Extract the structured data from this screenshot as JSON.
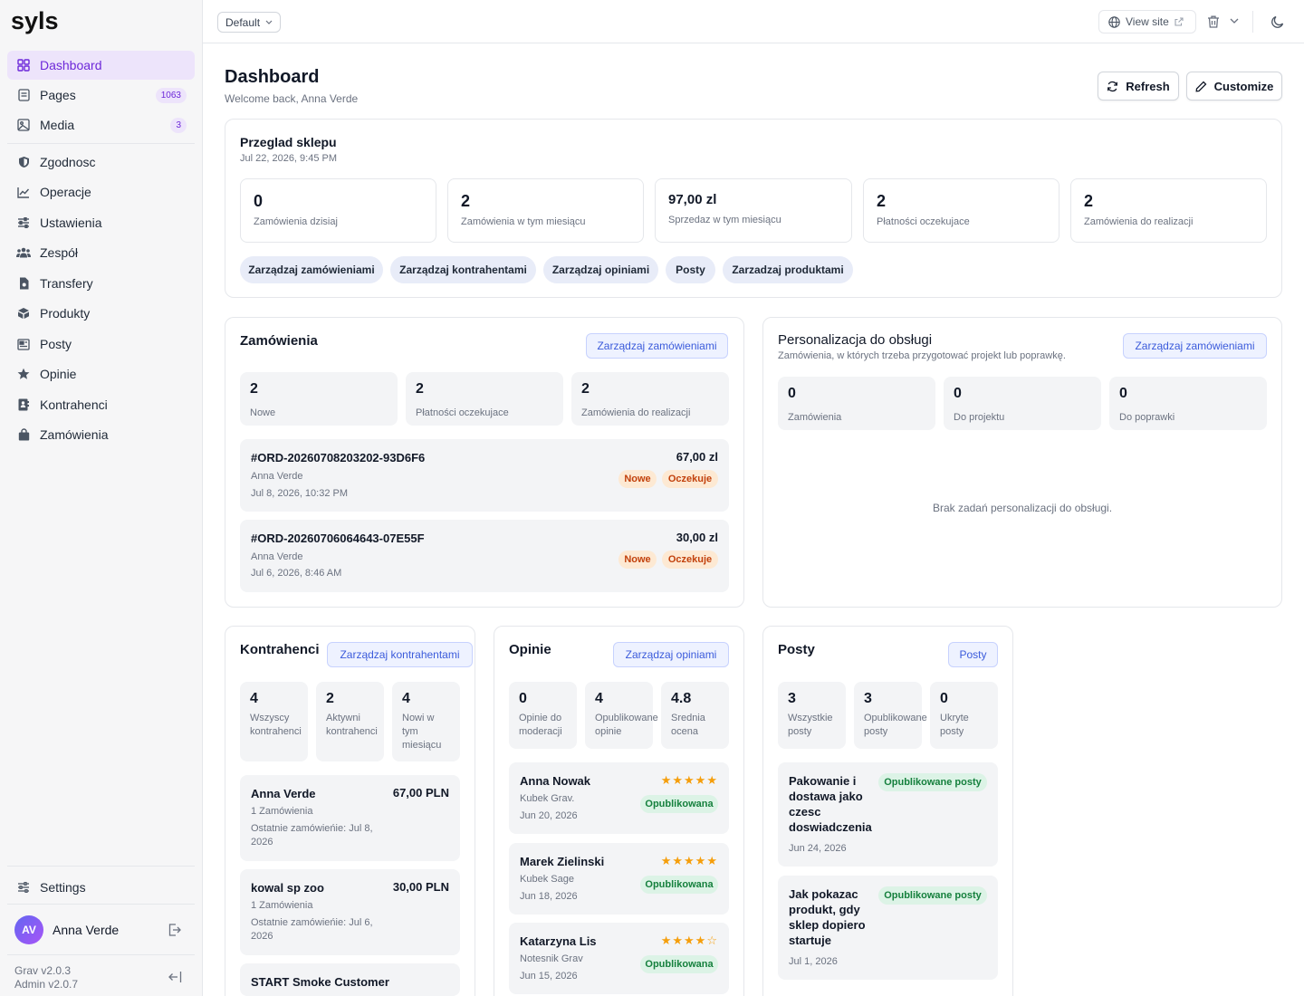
{
  "brand": {
    "logo_text": "syls"
  },
  "sidebar": {
    "items": [
      {
        "label": "Dashboard",
        "icon": "dashboard-icon"
      },
      {
        "label": "Pages",
        "icon": "pages-icon",
        "badge": "1063"
      },
      {
        "label": "Media",
        "icon": "media-icon",
        "badge": "3"
      },
      {
        "label": "Zgodnosc",
        "icon": "shield-icon"
      },
      {
        "label": "Operacje",
        "icon": "chart-line-icon"
      },
      {
        "label": "Ustawienia",
        "icon": "sliders-icon"
      },
      {
        "label": "Zespół",
        "icon": "team-icon"
      },
      {
        "label": "Transfery",
        "icon": "file-transfer-icon"
      },
      {
        "label": "Produkty",
        "icon": "box-icon"
      },
      {
        "label": "Posty",
        "icon": "newspaper-icon"
      },
      {
        "label": "Opinie",
        "icon": "star-icon"
      },
      {
        "label": "Kontrahenci",
        "icon": "contacts-icon"
      },
      {
        "label": "Zamówienia",
        "icon": "bag-icon"
      }
    ],
    "settings_label": "Settings",
    "user": {
      "initials": "AV",
      "name": "Anna Verde"
    },
    "version": {
      "grav": "Grav v2.0.3",
      "admin": "Admin v2.0.7"
    }
  },
  "topbar": {
    "environment": "Default",
    "view_site": "View site"
  },
  "header": {
    "title": "Dashboard",
    "subtitle": "Welcome back, Anna Verde",
    "refresh": "Refresh",
    "customize": "Customize"
  },
  "overview": {
    "title": "Przeglad sklepu",
    "timestamp": "Jul 22, 2026, 9:45 PM",
    "stats": [
      {
        "value": "0",
        "label": "Zamówienia dzisiaj"
      },
      {
        "value": "2",
        "label": "Zamówienia w tym miesiącu"
      },
      {
        "value": "97,00 zl",
        "label": "Sprzedaz w tym miesiącu"
      },
      {
        "value": "2",
        "label": "Płatności oczekujace"
      },
      {
        "value": "2",
        "label": "Zamówienia do realizacji"
      }
    ],
    "quick_links": [
      "Zarządzaj zamówieniami",
      "Zarządzaj kontrahentami",
      "Zarządzaj opiniami",
      "Posty",
      "Zarzadzaj produktami"
    ]
  },
  "orders": {
    "title": "Zamówienia",
    "manage": "Zarządzaj zamówieniami",
    "stats": [
      {
        "value": "2",
        "label": "Nowe"
      },
      {
        "value": "2",
        "label": "Płatności oczekujace"
      },
      {
        "value": "2",
        "label": "Zamówienia do realizacji"
      }
    ],
    "list": [
      {
        "id": "#ORD-20260708203202-93D6F6",
        "customer": "Anna Verde",
        "date": "Jul 8, 2026, 10:32 PM",
        "amount": "67,00 zl",
        "tags": [
          "Nowe",
          "Oczekuje"
        ]
      },
      {
        "id": "#ORD-20260706064643-07E55F",
        "customer": "Anna Verde",
        "date": "Jul 6, 2026, 8:46 AM",
        "amount": "30,00 zl",
        "tags": [
          "Nowe",
          "Oczekuje"
        ]
      }
    ]
  },
  "personalization": {
    "title": "Personalizacja do obsługi",
    "subtitle": "Zamówienia, w których trzeba przygotować projekt lub poprawkę.",
    "manage": "Zarządzaj zamówieniami",
    "stats": [
      {
        "value": "0",
        "label": "Zamówienia"
      },
      {
        "value": "0",
        "label": "Do projektu"
      },
      {
        "value": "0",
        "label": "Do poprawki"
      }
    ],
    "empty": "Brak zadań personalizacji do obsługi."
  },
  "contractors": {
    "title": "Kontrahenci",
    "manage": "Zarządzaj kontrahentami",
    "stats": [
      {
        "value": "4",
        "label_lines": [
          "Wszyscy",
          "kontrahenci"
        ]
      },
      {
        "value": "2",
        "label_lines": [
          "Aktywni",
          "kontrahenci"
        ]
      },
      {
        "value": "4",
        "label_lines": [
          "Nowi w",
          "tym",
          "miesiącu"
        ]
      }
    ],
    "list": [
      {
        "name": "Anna Verde",
        "orders": "1 Zamówienia",
        "last_line1": "Ostatnie zamówieńie: Jul 8,",
        "last_line2": "2026",
        "amount": "67,00 PLN"
      },
      {
        "name": "kowal sp zoo",
        "orders": "1 Zamówienia",
        "last_line1": "Ostatnie zamówieńie: Jul 6,",
        "last_line2": "2026",
        "amount": "30,00 PLN"
      },
      {
        "name": "START Smoke Customer"
      }
    ]
  },
  "reviews": {
    "title": "Opinie",
    "manage": "Zarządzaj opiniami",
    "stats": [
      {
        "value": "0",
        "label_lines": [
          "Opinie do",
          "moderacji"
        ]
      },
      {
        "value": "4",
        "label_lines": [
          "Opublikowane",
          "opinie"
        ]
      },
      {
        "value": "4.8",
        "label_lines": [
          "Srednia",
          "ocena"
        ]
      }
    ],
    "list": [
      {
        "author": "Anna Nowak",
        "product": "Kubek Grav.",
        "date": "Jun 20, 2026",
        "rating": 5,
        "status": "Opublikowana"
      },
      {
        "author": "Marek Zielinski",
        "product": "Kubek Sage",
        "date": "Jun 18, 2026",
        "rating": 5,
        "status": "Opublikowana"
      },
      {
        "author": "Katarzyna Lis",
        "product": "Notesnik Grav",
        "date": "Jun 15, 2026",
        "rating": 4,
        "status": "Opublikowana"
      }
    ]
  },
  "posts": {
    "title": "Posty",
    "manage": "Posty",
    "stats": [
      {
        "value": "3",
        "label_lines": [
          "Wszystkie",
          "posty"
        ]
      },
      {
        "value": "3",
        "label_lines": [
          "Opublikowane",
          "posty"
        ]
      },
      {
        "value": "0",
        "label_lines": [
          "Ukryte",
          "posty"
        ]
      }
    ],
    "list": [
      {
        "title_lines": [
          "Pakowanie i",
          "dostawa jako",
          "czesc",
          "doswiadczenia"
        ],
        "date": "Jun 24, 2026",
        "status": "Opublikowane posty"
      },
      {
        "title_lines": [
          "Jak pokazac",
          "produkt, gdy",
          "sklep dopiero",
          "startuje"
        ],
        "date": "Jul 1, 2026",
        "status": "Opublikowane posty"
      }
    ]
  },
  "colors": {
    "accent": "#6d28d9",
    "accent_bg": "#ede4fb",
    "link": "#3b5bdb",
    "star": "#f59e0b",
    "warning": "#c2410c",
    "success": "#15803d"
  }
}
